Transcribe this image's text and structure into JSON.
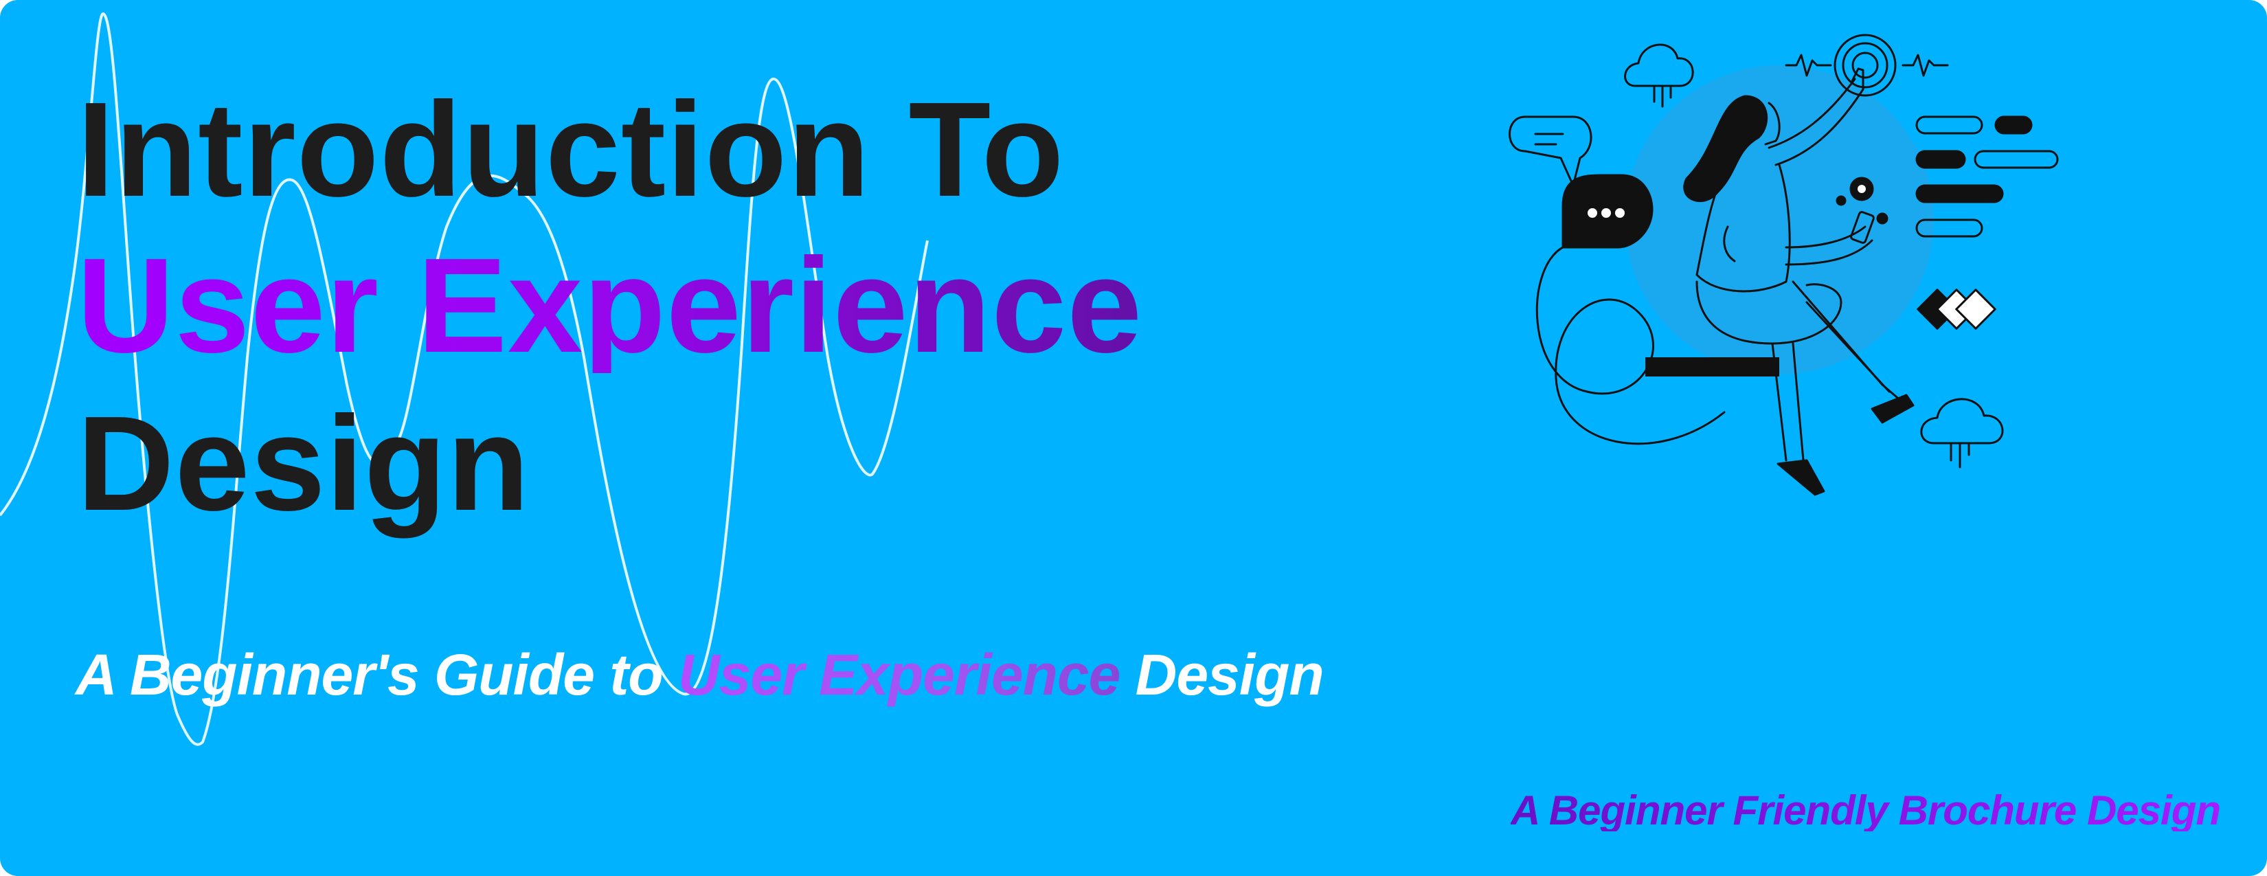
{
  "banner": {
    "title_line1": "Introduction To",
    "title_line2": "User Experience",
    "title_line3": "Design",
    "subtitle_prefix": "A Beginner's Guide to ",
    "subtitle_accent": "User Experience",
    "subtitle_suffix": " Design",
    "footer_note": "A Beginner Friendly Brochure Design"
  },
  "illustration": {
    "subject": "person-interacting-with-interface"
  },
  "colors": {
    "background": "#00b2ff",
    "title_dark": "#1d1d1d",
    "accent_purple": "#a200ff",
    "accent_dark_purple": "#6410a8",
    "subtitle_white": "#ffffff",
    "wave_line": "#dff6ff"
  }
}
